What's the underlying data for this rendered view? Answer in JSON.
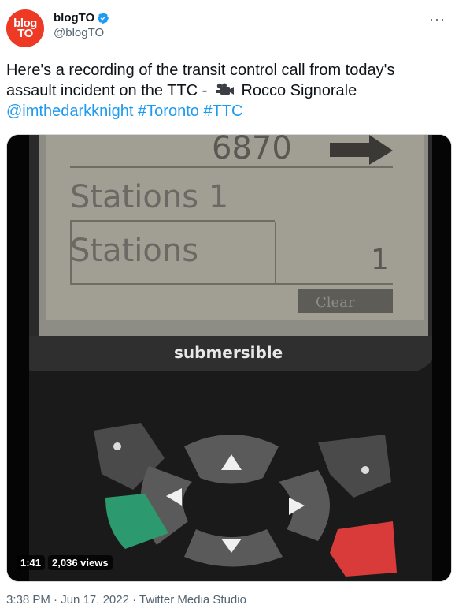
{
  "account": {
    "avatar_line1": "blog",
    "avatar_line2": "TO",
    "display_name": "blogTO",
    "handle": "@blogTO",
    "verified_icon": "verified-badge-icon",
    "more_label": "···"
  },
  "tweet": {
    "text_part1": "Here's a recording of the transit control call from today's assault incident on the TTC -",
    "text_part2": "Rocco Signorale",
    "mention": "@imthedarkknight",
    "hashtag1": "#Toronto",
    "hashtag2": "#TTC"
  },
  "video": {
    "screen_line1": "Stations 1",
    "screen_line2": "Stations",
    "screen_value": "1",
    "screen_top": "6870",
    "clear_label": "Clear",
    "device_label": "submersible",
    "duration": "1:41",
    "views": "2,036 views"
  },
  "meta": {
    "time": "3:38 PM",
    "date": "Jun 17, 2022",
    "separator": "·",
    "source": "Twitter Media Studio"
  },
  "colors": {
    "link": "#1d9bf0",
    "avatar_bg": "#ee3a24",
    "muted": "#536471"
  }
}
